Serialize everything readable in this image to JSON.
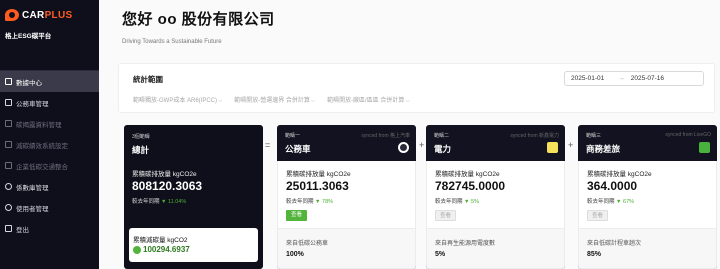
{
  "brand": {
    "part_a": "CAR",
    "part_b": "PLUS"
  },
  "platform": "格上ESG碳平台",
  "nav": [
    {
      "label": "數據中心",
      "state": "active"
    },
    {
      "label": "公務車管理",
      "state": "normal"
    },
    {
      "label": "碳揭露資料管理",
      "state": "disabled"
    },
    {
      "label": "減碳績效系統設定",
      "state": "disabled"
    },
    {
      "label": "企業低碳交通整合",
      "state": "disabled"
    },
    {
      "label": "係數庫管理",
      "state": "normal"
    },
    {
      "label": "使用者管理",
      "state": "normal"
    },
    {
      "label": "登出",
      "state": "normal"
    }
  ],
  "header": {
    "title": "您好 oo 股份有限公司",
    "subtitle": "Driving Towards a Sustainable Future"
  },
  "stats": {
    "title": "統計範圍",
    "date_start": "2025-01-01",
    "date_arrow": "→",
    "date_end": "2025-07-16",
    "filters": [
      "範疇獨放-GWP成本 AR6(IPCC)",
      "範疇開放-營運邊界 合併計算",
      "範疇開放-廠區/區區 合併計算"
    ]
  },
  "total_card": {
    "tag": "3個範疇",
    "name": "總計",
    "emission_label": "累積碳排放量 kgCO2e",
    "emission_value": "808120.3063",
    "yoy_label": "較去年同期",
    "yoy_value": "▼ 11.04%",
    "reduction_label": "累積減碳量 kgCO2",
    "reduction_value": "100294.6937"
  },
  "operators": [
    "=",
    "+",
    "+"
  ],
  "categories": [
    {
      "tag": "範疇一",
      "name": "公務車",
      "source": "synced from 格上汽車",
      "badge_color": "#2b2b3a",
      "emission_label": "累積碳排放量 kgCO2e",
      "emission_value": "25011.3063",
      "yoy_label": "較去年同期",
      "yoy_value": "▼ 78%",
      "button": "查看",
      "button_state": "primary",
      "foot_label": "來自低碳公務車",
      "foot_value": "100%"
    },
    {
      "tag": "範疇二",
      "name": "電力",
      "source": "synced from 新鑫電力",
      "badge_color": "#f6e15a",
      "emission_label": "累積碳排放量 kgCO2e",
      "emission_value": "782745.0000",
      "yoy_label": "較去年同期",
      "yoy_value": "▼ 5%",
      "button": "查看",
      "button_state": "off",
      "foot_label": "來自再生能源用電度數",
      "foot_value": "5%"
    },
    {
      "tag": "範疇三",
      "name": "商務差旅",
      "source": "synced from LiveGO",
      "badge_color": "#49b23c",
      "emission_label": "累積碳排放量 kgCO2e",
      "emission_value": "364.0000",
      "yoy_label": "較去年同期",
      "yoy_value": "▼ 67%",
      "button": "查看",
      "button_state": "off",
      "foot_label": "來自低碳計程車趟次",
      "foot_value": "85%"
    }
  ]
}
